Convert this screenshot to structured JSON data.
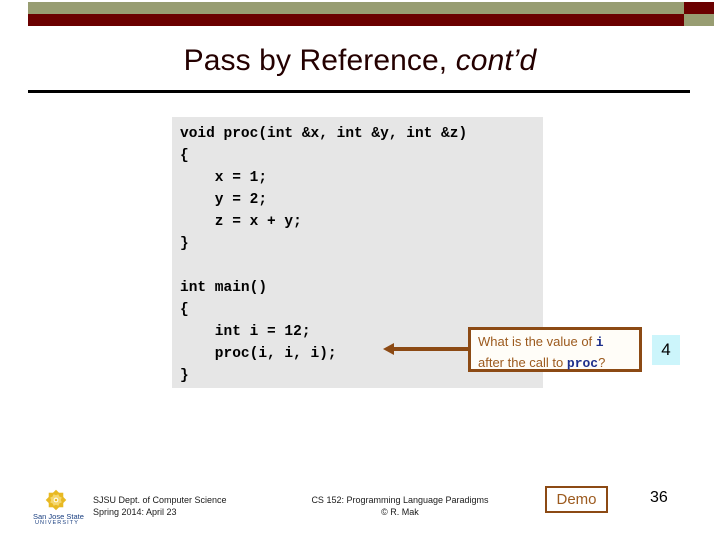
{
  "theme": {
    "banner_green": "#989d72",
    "banner_maroon": "#6b0000",
    "title_color": "#240000",
    "code_bg": "#e6e6e6",
    "callout_border": "#8c4a14",
    "callout_text": "#9c5a1e",
    "callout_code": "#1d2f8c",
    "answer_highlight": "#ccf5fb",
    "logo_gold": "#f0c419",
    "logo_blue": "#1a3f80"
  },
  "slide": {
    "title_main": "Pass by Reference,",
    "title_italic": "cont’d"
  },
  "code": {
    "text": "void proc(int &x, int &y, int &z)\n{\n    x = 1;\n    y = 2;\n    z = x + y;\n}\n\nint main()\n{\n    int i = 12;\n    proc(i, i, i);\n}"
  },
  "callout": {
    "line1_a": "What is the value of ",
    "line1_code": "i",
    "line2_a": "after the call to ",
    "line2_code": "proc",
    "line2_b": "?"
  },
  "answer": {
    "value": "4"
  },
  "footer": {
    "logo_name": "San Jose State",
    "logo_sub": "UNIVERSITY",
    "left_line1": "SJSU Dept. of Computer Science",
    "left_line2": "Spring 2014: April 23",
    "center_line1": "CS 152: Programming Language Paradigms",
    "center_line2": "© R. Mak",
    "demo_label": "Demo",
    "page_number": "36"
  }
}
